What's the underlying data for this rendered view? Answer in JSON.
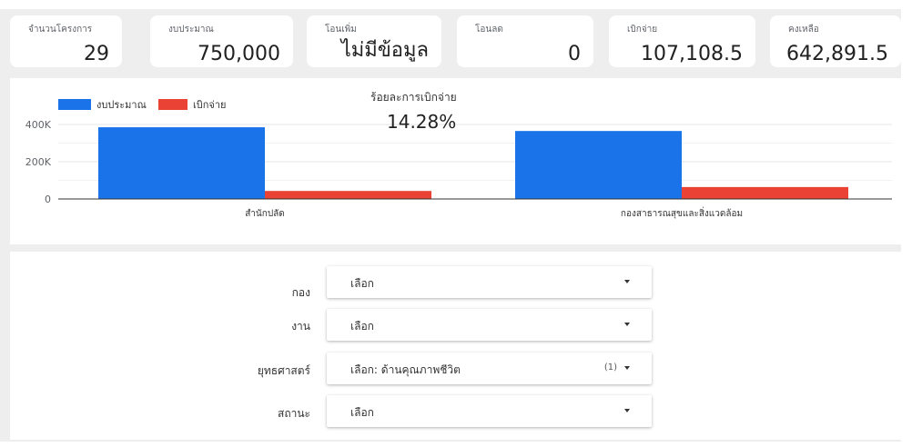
{
  "kpis": [
    {
      "label": "จำนวนโครงการ",
      "value": "29"
    },
    {
      "label": "งบประมาณ",
      "value": "750,000"
    },
    {
      "label": "โอนเพิ่ม",
      "value": "ไม่มีข้อมูล"
    },
    {
      "label": "โอนลด",
      "value": "0"
    },
    {
      "label": "เบิกจ่าย",
      "value": "107,108.5"
    },
    {
      "label": "คงเหลือ",
      "value": "642,891.5"
    }
  ],
  "summary": {
    "label": "ร้อยละการเบิกจ่าย",
    "value": "14.28%"
  },
  "chart_data": {
    "type": "bar",
    "categories": [
      "สำนักปลัด",
      "กองสาธารณสุขและสิ่งแวดล้อม"
    ],
    "series": [
      {
        "name": "งบประมาณ",
        "color": "#1a73e8",
        "values": [
          385000,
          365000
        ]
      },
      {
        "name": "เบิกจ่าย",
        "color": "#ea4335",
        "values": [
          43000,
          64108.5
        ]
      }
    ],
    "yticks": [
      {
        "value": 0,
        "label": "0"
      },
      {
        "value": 200000,
        "label": "200K"
      },
      {
        "value": 400000,
        "label": "400K"
      }
    ],
    "ylim": [
      0,
      450000
    ],
    "grid": true,
    "legend_position": "top-left"
  },
  "filters": [
    {
      "label": "กอง",
      "value": "เลือก",
      "count": ""
    },
    {
      "label": "งาน",
      "value": "เลือก",
      "count": ""
    },
    {
      "label": "ยุทธศาสตร์",
      "value": "เลือก: ด้านคุณภาพชีวิต",
      "count": "(1)"
    },
    {
      "label": "สถานะ",
      "value": "เลือก",
      "count": ""
    }
  ]
}
